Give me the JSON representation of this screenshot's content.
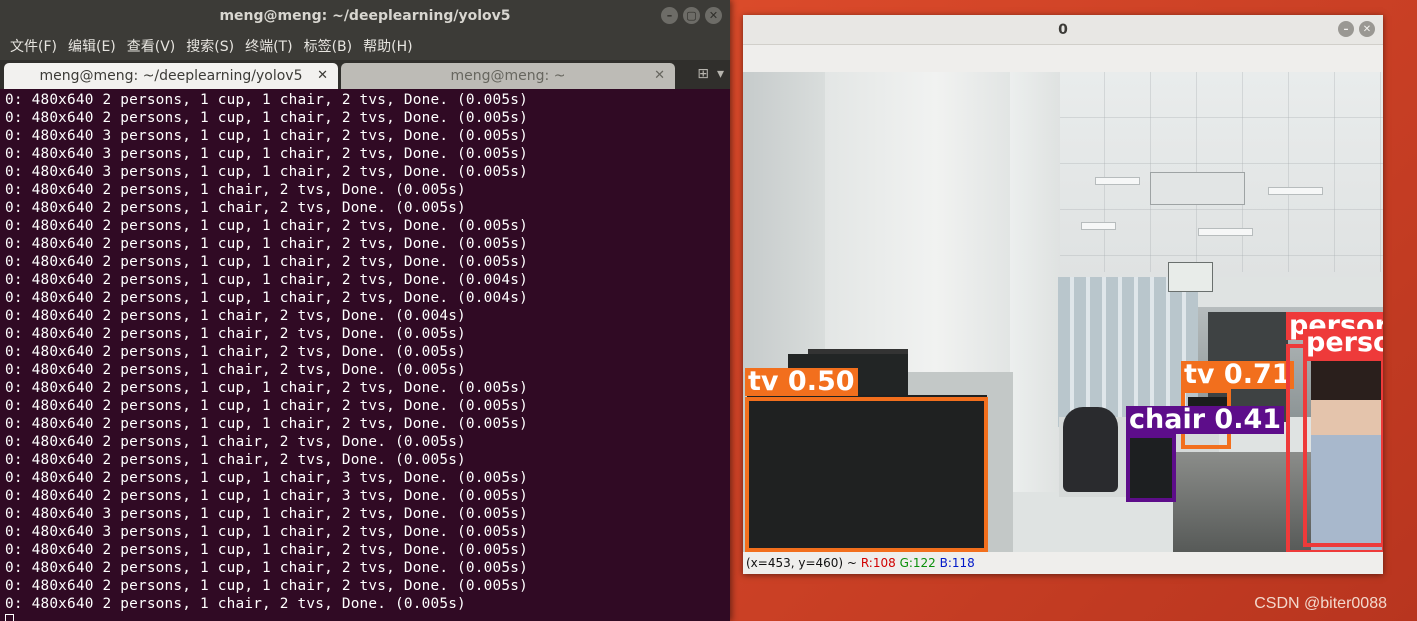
{
  "terminal": {
    "title": "meng@meng: ~/deeplearning/yolov5",
    "menu": [
      "文件(F)",
      "编辑(E)",
      "查看(V)",
      "搜索(S)",
      "终端(T)",
      "标签(B)",
      "帮助(H)"
    ],
    "tabs": [
      {
        "label": "meng@meng: ~/deeplearning/yolov5"
      },
      {
        "label": "meng@meng: ~"
      }
    ],
    "lines": [
      "0: 480x640 2 persons, 1 cup, 1 chair, 2 tvs, Done. (0.005s)",
      "0: 480x640 2 persons, 1 cup, 1 chair, 2 tvs, Done. (0.005s)",
      "0: 480x640 3 persons, 1 cup, 1 chair, 2 tvs, Done. (0.005s)",
      "0: 480x640 3 persons, 1 cup, 1 chair, 2 tvs, Done. (0.005s)",
      "0: 480x640 3 persons, 1 cup, 1 chair, 2 tvs, Done. (0.005s)",
      "0: 480x640 2 persons, 1 chair, 2 tvs, Done. (0.005s)",
      "0: 480x640 2 persons, 1 chair, 2 tvs, Done. (0.005s)",
      "0: 480x640 2 persons, 1 cup, 1 chair, 2 tvs, Done. (0.005s)",
      "0: 480x640 2 persons, 1 cup, 1 chair, 2 tvs, Done. (0.005s)",
      "0: 480x640 2 persons, 1 cup, 1 chair, 2 tvs, Done. (0.005s)",
      "0: 480x640 2 persons, 1 cup, 1 chair, 2 tvs, Done. (0.004s)",
      "0: 480x640 2 persons, 1 cup, 1 chair, 2 tvs, Done. (0.004s)",
      "0: 480x640 2 persons, 1 chair, 2 tvs, Done. (0.004s)",
      "0: 480x640 2 persons, 1 chair, 2 tvs, Done. (0.005s)",
      "0: 480x640 2 persons, 1 chair, 2 tvs, Done. (0.005s)",
      "0: 480x640 2 persons, 1 chair, 2 tvs, Done. (0.005s)",
      "0: 480x640 2 persons, 1 cup, 1 chair, 2 tvs, Done. (0.005s)",
      "0: 480x640 2 persons, 1 cup, 1 chair, 2 tvs, Done. (0.005s)",
      "0: 480x640 2 persons, 1 cup, 1 chair, 2 tvs, Done. (0.005s)",
      "0: 480x640 2 persons, 1 chair, 2 tvs, Done. (0.005s)",
      "0: 480x640 2 persons, 1 chair, 2 tvs, Done. (0.005s)",
      "0: 480x640 2 persons, 1 cup, 1 chair, 3 tvs, Done. (0.005s)",
      "0: 480x640 2 persons, 1 cup, 1 chair, 3 tvs, Done. (0.005s)",
      "0: 480x640 3 persons, 1 cup, 1 chair, 2 tvs, Done. (0.005s)",
      "0: 480x640 3 persons, 1 cup, 1 chair, 2 tvs, Done. (0.005s)",
      "0: 480x640 2 persons, 1 cup, 1 chair, 2 tvs, Done. (0.005s)",
      "0: 480x640 2 persons, 1 cup, 1 chair, 2 tvs, Done. (0.005s)",
      "0: 480x640 2 persons, 1 cup, 1 chair, 2 tvs, Done. (0.005s)",
      "0: 480x640 2 persons, 1 chair, 2 tvs, Done. (0.005s)"
    ]
  },
  "viewer": {
    "title": "0",
    "detections": [
      {
        "label": "tv 0.50",
        "color": "#f26f1d"
      },
      {
        "label": "tv 0.71",
        "color": "#f26f1d"
      },
      {
        "label": "chair 0.41",
        "color": "#5d0d8a"
      },
      {
        "label": "persor",
        "color": "#ee3a3a"
      },
      {
        "label": "perso",
        "color": "#ee3a3a"
      }
    ],
    "status": {
      "coords": "(x=453, y=460) ~",
      "r": "R:108",
      "g": "G:122",
      "b": "B:118"
    }
  },
  "watermark": "CSDN @biter0088"
}
